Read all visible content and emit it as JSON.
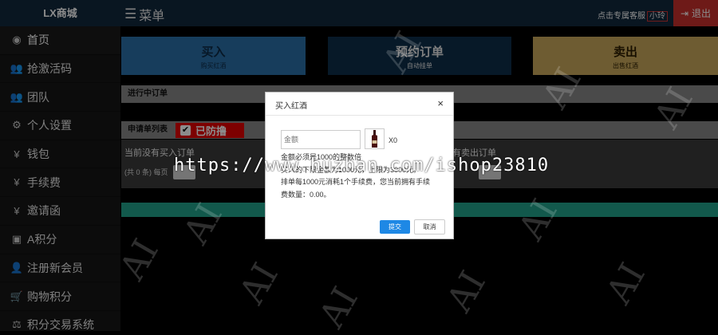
{
  "brand": "LX商城",
  "sidebar": {
    "items": [
      {
        "icon": "dashboard-icon",
        "glyph": "◉",
        "label": "首页"
      },
      {
        "icon": "users-icon",
        "glyph": "👥",
        "label": "抢激活码"
      },
      {
        "icon": "team-icon",
        "glyph": "👥",
        "label": "团队"
      },
      {
        "icon": "gears-icon",
        "glyph": "⚙",
        "label": "个人设置"
      },
      {
        "icon": "yen-icon",
        "glyph": "¥",
        "label": "钱包"
      },
      {
        "icon": "yen-icon",
        "glyph": "¥",
        "label": "手续费"
      },
      {
        "icon": "yen-icon",
        "glyph": "¥",
        "label": "邀请函"
      },
      {
        "icon": "money-icon",
        "glyph": "▣",
        "label": "A积分"
      },
      {
        "icon": "user-plus-icon",
        "glyph": "👤",
        "label": "注册新会员"
      },
      {
        "icon": "cart-icon",
        "glyph": "🛒",
        "label": "购物积分"
      },
      {
        "icon": "balance-icon",
        "glyph": "⚖",
        "label": "积分交易系统"
      }
    ]
  },
  "topbar": {
    "menu_label": "菜单",
    "service_prefix": "点击专属客服",
    "service_name": "小玲",
    "logout_label": "退出"
  },
  "actions": {
    "buy": {
      "title": "买入",
      "sub": "购买红酒"
    },
    "reserve": {
      "title": "预约订单",
      "sub": "自动挂单"
    },
    "sell": {
      "title": "卖出",
      "sub": "出售红酒"
    }
  },
  "sections": {
    "progress_title": "进行中订单",
    "apply_title": "申请单列表",
    "protect_badge": "已防撸",
    "no_buy": "当前没有买入订单",
    "buy_count": "(共 0 条)  每页",
    "no_sell": "有卖出订单"
  },
  "modal": {
    "title": "买入红酒",
    "close": "×",
    "amount_placeholder": "金额",
    "wine_qty": "X0",
    "line1": "金额必须是1000的整数倍",
    "line2": "买入的下限金额为1000元，上限为3000元。",
    "line3": "排单每1000元消耗1个手续费，您当前拥有手续",
    "line4": "费数量：0.00。",
    "confirm": "提交",
    "cancel": "取消"
  },
  "watermark": {
    "url": "https://www.huzhan.com/ishop23810",
    "ai_text": "AI"
  },
  "colors": {
    "topbar": "#11283d",
    "buy": "#2b6fa8",
    "reserve": "#0e2e49",
    "sell": "#c9a85b",
    "logout": "#c9302c",
    "protect": "#e30000",
    "green_bar": "#21a38a",
    "confirm": "#1e88e5"
  }
}
